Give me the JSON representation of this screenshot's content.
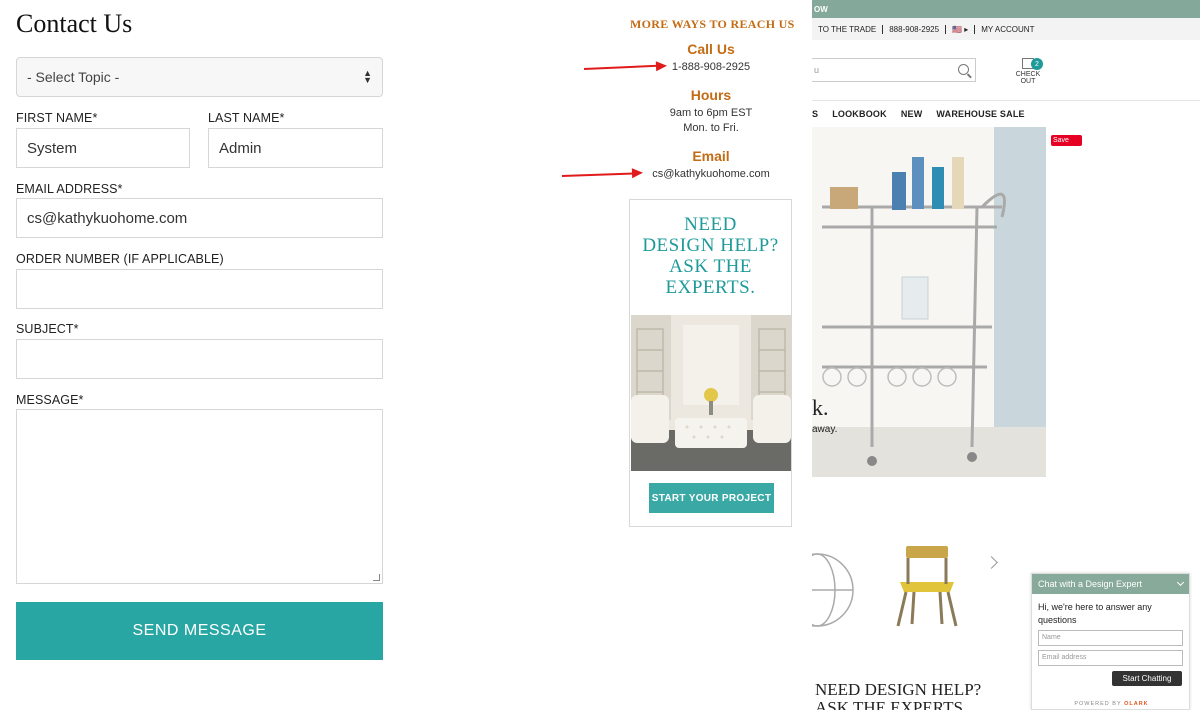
{
  "form": {
    "title": "Contact Us",
    "topic_select": "- Select Topic -",
    "first_name_label": "FIRST NAME*",
    "first_name_value": "System",
    "last_name_label": "LAST NAME*",
    "last_name_value": "Admin",
    "email_label": "EMAIL ADDRESS*",
    "email_value": "cs@kathykuohome.com",
    "order_label": "ORDER NUMBER (IF APPLICABLE)",
    "order_value": "",
    "subject_label": "SUBJECT*",
    "subject_value": "",
    "message_label": "MESSAGE*",
    "message_value": "",
    "send_label": "SEND MESSAGE"
  },
  "contact_info": {
    "title": "MORE WAYS TO REACH US",
    "call_heading": "Call Us",
    "phone": "1-888-908-2925",
    "hours_heading": "Hours",
    "hours_line1": "9am to 6pm EST",
    "hours_line2": "Mon. to Fri.",
    "email_heading": "Email",
    "email": "cs@kathykuohome.com"
  },
  "ad": {
    "headline": [
      "NEED",
      "DESIGN HELP?",
      "ASK THE",
      "EXPERTS."
    ],
    "button": "START YOUR PROJECT"
  },
  "site": {
    "topbar": "OW",
    "util": [
      "TO THE TRADE",
      "888-908-2925",
      "🇺🇸 ▸",
      "MY ACCOUNT"
    ],
    "search_placeholder": "u",
    "cart_label": "CHECK OUT",
    "cart_count": "2",
    "nav": [
      "S",
      "LOOKBOOK",
      "NEW",
      "WAREHOUSE SALE"
    ],
    "save": "Save",
    "hero_text1": "k.",
    "hero_text2": "away.",
    "bottom_title_1": "NEED DESIGN HELP?",
    "bottom_title_2": "ASK THE EXPERTS"
  },
  "chat": {
    "header": "Chat with a Design Expert",
    "message": "Hi, we're here to answer any questions",
    "name_placeholder": "Name",
    "email_placeholder": "Email address",
    "button": "Start Chatting",
    "powered_prefix": "POWERED BY ",
    "powered_brand": "OLARK"
  },
  "colors": {
    "accent_teal": "#27a6a4",
    "heading_orange": "#c46c14",
    "annotation_red": "#e11b1b"
  }
}
